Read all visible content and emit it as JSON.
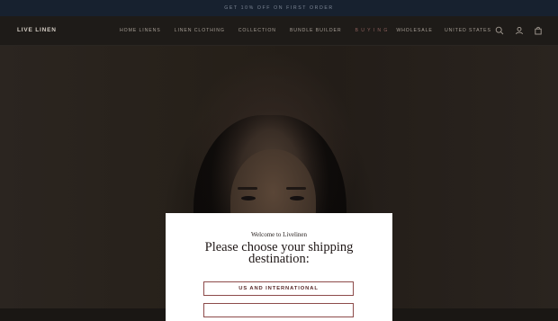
{
  "announcement": {
    "text": "GET 10% OFF ON FIRST ORDER"
  },
  "header": {
    "logo": "LIVE LINEN",
    "nav_items": [
      {
        "label": "HOME LINENS"
      },
      {
        "label": "LINEN CLOTHING"
      },
      {
        "label": "COLLECTION"
      },
      {
        "label": "BUNDLE BUILDER"
      },
      {
        "label": "B U Y I N G"
      },
      {
        "label": "WHOLESALE"
      }
    ],
    "country": "UNITED STATES",
    "icons": [
      "search-icon",
      "account-icon",
      "cart-icon"
    ]
  },
  "modal": {
    "welcome": "Welcome to Livelinen",
    "heading_line1": "Please choose your shipping",
    "heading_line2": "destination:",
    "buttons": [
      {
        "label": "US AND INTERNATIONAL"
      }
    ]
  },
  "colors": {
    "announcement_bg": "#17212f",
    "accent": "#8d4b4a",
    "modal_bg": "#ffffff"
  }
}
